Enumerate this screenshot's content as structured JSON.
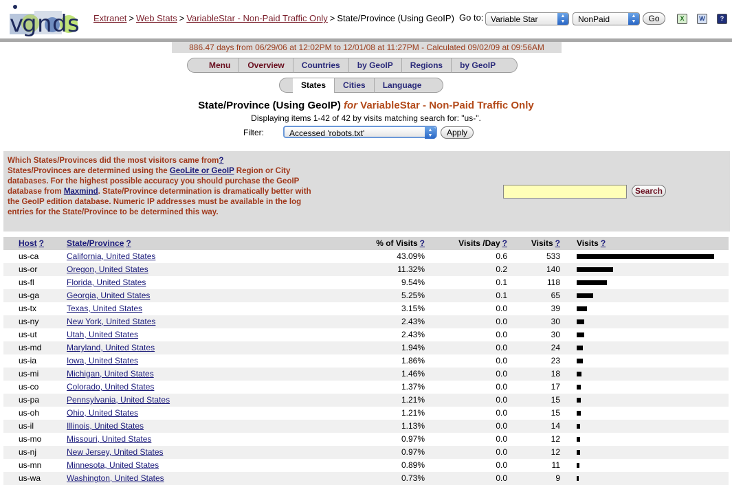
{
  "header": {
    "breadcrumb": [
      {
        "label": "Extranet",
        "link": true
      },
      {
        "label": "Web Stats",
        "link": true
      },
      {
        "label": "VariableStar - Non-Paid Traffic Only",
        "link": true
      },
      {
        "label": "State/Province (Using GeoIP)",
        "link": false
      }
    ],
    "goto_label": "Go to:",
    "site_select": "Variable Star",
    "profile_select": "NonPaid",
    "go_label": "Go",
    "icons": [
      "excel-icon",
      "word-icon",
      "help-icon"
    ],
    "help_glyph": "?"
  },
  "daterange": "886.47 days from 06/29/06 at 12:02PM to 12/01/08 at 11:27PM - Calculated 09/02/09 at 09:56AM",
  "tabs_primary": [
    "Menu",
    "Overview",
    "Countries",
    "by GeoIP",
    "Regions",
    "by GeoIP"
  ],
  "tabs_secondary": [
    "States",
    "Cities",
    "Language"
  ],
  "active_secondary": "States",
  "title": {
    "main": "State/Province (Using GeoIP)",
    "for": "for",
    "site": "VariableStar - Non-Paid Traffic Only"
  },
  "displaying": "Displaying items 1-42 of 42 by visits matching search for: \"us-\".",
  "filter": {
    "label": "Filter:",
    "value": "Accessed 'robots.txt'",
    "apply_label": "Apply"
  },
  "info": {
    "question": "Which States/Provinces did the most visitors came from",
    "q_mark": "?",
    "text1": "States/Provinces are determined using the",
    "link1": "GeoLite or GeoIP",
    "text2": "Region or City databases. For the highest possible accuracy you should purchase the GeoIP database from",
    "link2": "Maxmind",
    "text3": ". State/Province determination is dramatically better with the GeoIP edition database. Numeric IP addresses must be available in the log entries for the State/Province to be determined this way."
  },
  "search": {
    "placeholder": "",
    "button": "Search"
  },
  "table": {
    "headers": {
      "host": "Host",
      "state": "State/Province",
      "pct": "% of Visits",
      "vpd": "Visits /Day",
      "visits": "Visits",
      "bar": "Visits",
      "q": "?"
    },
    "max_visits": 533,
    "rows": [
      {
        "host": "us-ca",
        "state": "California, United States",
        "pct": "43.09%",
        "vpd": "0.6",
        "visits": 533
      },
      {
        "host": "us-or",
        "state": "Oregon, United States",
        "pct": "11.32%",
        "vpd": "0.2",
        "visits": 140
      },
      {
        "host": "us-fl",
        "state": "Florida, United States",
        "pct": "9.54%",
        "vpd": "0.1",
        "visits": 118
      },
      {
        "host": "us-ga",
        "state": "Georgia, United States",
        "pct": "5.25%",
        "vpd": "0.1",
        "visits": 65
      },
      {
        "host": "us-tx",
        "state": "Texas, United States",
        "pct": "3.15%",
        "vpd": "0.0",
        "visits": 39
      },
      {
        "host": "us-ny",
        "state": "New York, United States",
        "pct": "2.43%",
        "vpd": "0.0",
        "visits": 30
      },
      {
        "host": "us-ut",
        "state": "Utah, United States",
        "pct": "2.43%",
        "vpd": "0.0",
        "visits": 30
      },
      {
        "host": "us-md",
        "state": "Maryland, United States",
        "pct": "1.94%",
        "vpd": "0.0",
        "visits": 24
      },
      {
        "host": "us-ia",
        "state": "Iowa, United States",
        "pct": "1.86%",
        "vpd": "0.0",
        "visits": 23
      },
      {
        "host": "us-mi",
        "state": "Michigan, United States",
        "pct": "1.46%",
        "vpd": "0.0",
        "visits": 18
      },
      {
        "host": "us-co",
        "state": "Colorado, United States",
        "pct": "1.37%",
        "vpd": "0.0",
        "visits": 17
      },
      {
        "host": "us-pa",
        "state": "Pennsylvania, United States",
        "pct": "1.21%",
        "vpd": "0.0",
        "visits": 15
      },
      {
        "host": "us-oh",
        "state": "Ohio, United States",
        "pct": "1.21%",
        "vpd": "0.0",
        "visits": 15
      },
      {
        "host": "us-il",
        "state": "Illinois, United States",
        "pct": "1.13%",
        "vpd": "0.0",
        "visits": 14
      },
      {
        "host": "us-mo",
        "state": "Missouri, United States",
        "pct": "0.97%",
        "vpd": "0.0",
        "visits": 12
      },
      {
        "host": "us-nj",
        "state": "New Jersey, United States",
        "pct": "0.97%",
        "vpd": "0.0",
        "visits": 12
      },
      {
        "host": "us-mn",
        "state": "Minnesota, United States",
        "pct": "0.89%",
        "vpd": "0.0",
        "visits": 11
      },
      {
        "host": "us-wa",
        "state": "Washington, United States",
        "pct": "0.73%",
        "vpd": "0.0",
        "visits": 9
      }
    ]
  },
  "colors": {
    "maroon": "#7a1f2b",
    "rust": "#a0381a",
    "navy": "#1a1a7a",
    "panel": "#dcdcdc"
  }
}
